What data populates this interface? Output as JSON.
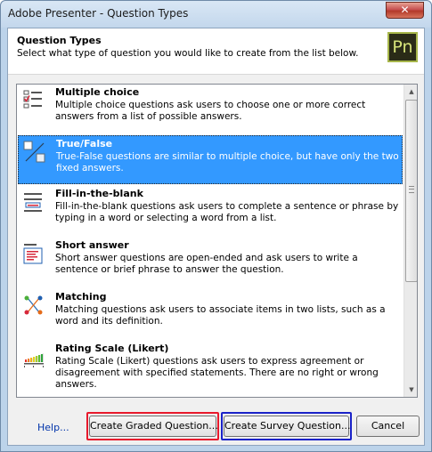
{
  "window": {
    "title": "Adobe Presenter - Question Types",
    "close_label": "✕"
  },
  "header": {
    "title": "Question Types",
    "subtitle": "Select what type of question you would like to create from the list below.",
    "logo_text": "Pn"
  },
  "items": [
    {
      "title": "Multiple choice",
      "desc": "Multiple choice questions ask users to choose one or more correct answers from a list of possible answers.",
      "icon": "multiple-choice-icon",
      "selected": false
    },
    {
      "title": "True/False",
      "desc": "True-False questions are similar to multiple choice, but have only the two fixed answers.",
      "icon": "true-false-icon",
      "selected": true
    },
    {
      "title": "Fill-in-the-blank",
      "desc": "Fill-in-the-blank questions ask users to complete a sentence or phrase by typing in a word or selecting a word from a list.",
      "icon": "fill-in-the-blank-icon",
      "selected": false
    },
    {
      "title": "Short answer",
      "desc": "Short answer questions are open-ended and ask users to write a sentence or brief phrase to answer the question.",
      "icon": "short-answer-icon",
      "selected": false
    },
    {
      "title": "Matching",
      "desc": "Matching questions ask users to associate items in two lists, such as a word and its definition.",
      "icon": "matching-icon",
      "selected": false
    },
    {
      "title": "Rating Scale (Likert)",
      "desc": "Rating Scale (Likert) questions ask users to express agreement or disagreement with specified statements. There are no right or wrong answers.",
      "icon": "rating-scale-icon",
      "selected": false
    }
  ],
  "footer": {
    "help_label": "Help...",
    "graded_label": "Create Graded Question...",
    "survey_label": "Create Survey Question...",
    "cancel_label": "Cancel"
  },
  "colors": {
    "selection": "#3399ff",
    "graded_highlight": "#e8192c",
    "survey_highlight": "#1a22c8",
    "accent_link": "#0033aa"
  }
}
